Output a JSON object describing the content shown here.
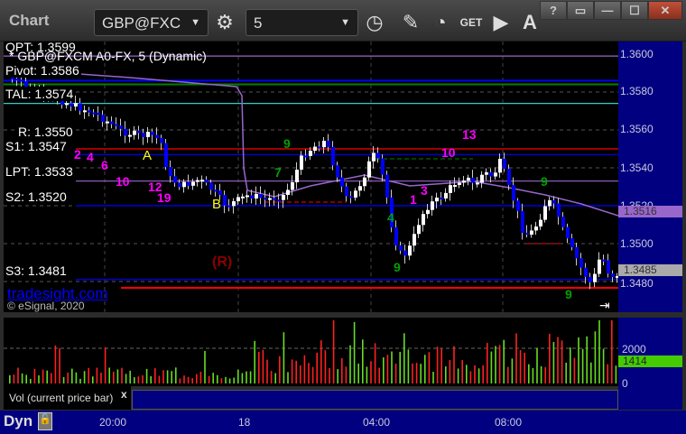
{
  "toolbar": {
    "title": "Chart",
    "symbol": "GBP@FXC",
    "interval": "5",
    "icons": [
      "gear-icon",
      "clock-icon",
      "pencil-icon",
      "studies-icon",
      "get-icon",
      "play-icon",
      "alert-icon"
    ],
    "get_label": "GET",
    "alert_label": "A"
  },
  "window": {
    "help": "?",
    "minimize": "—",
    "maximize": "☐",
    "close": "✕"
  },
  "chart": {
    "title": "* GBP@FXCM A0-FX, 5 (Dynamic)",
    "levels": [
      {
        "label": "QPT: 1.3599",
        "price": 1.3599,
        "color": "#9966cc"
      },
      {
        "label": "Pivot: 1.3586",
        "price": 1.3586,
        "color": "#0000ff"
      },
      {
        "label": "TAL: 1.3574",
        "price": 1.3574,
        "color": "#33cccc"
      },
      {
        "label": "R: 1.3550",
        "price": 1.355,
        "color": "#ff0000"
      },
      {
        "label": "S1: 1.3547",
        "price": 1.3547,
        "color": "#0000ff"
      },
      {
        "label": "LPT: 1.3533",
        "price": 1.3533,
        "color": "#9966cc"
      },
      {
        "label": "S2: 1.3520",
        "price": 1.352,
        "color": "#0000ff"
      },
      {
        "label": "S3: 1.3481",
        "price": 1.3481,
        "color": "#0000ff"
      }
    ],
    "price_ticks": [
      "1.3600",
      "1.3580",
      "1.3560",
      "1.3540",
      "1.3520",
      "1.3500",
      "1.3480"
    ],
    "ma_value": "1.3516",
    "last_price": "1.3485",
    "markers": {
      "a": "A",
      "b": "B",
      "r": "(R)"
    },
    "watermark": "tradesight.com",
    "copyright": "© eSignal, 2020",
    "colors": {
      "up": "#ffffff",
      "down": "#0000ff",
      "ma": "#9966cc",
      "background": "#000000",
      "axis": "#000080"
    }
  },
  "volume": {
    "label": "Vol (current price bar)",
    "close": "x",
    "ticks": [
      "2000",
      "0"
    ],
    "current": "1414"
  },
  "time_axis": {
    "mode": "Dyn",
    "ticks": [
      "20:00",
      "18",
      "04:00",
      "08:00"
    ]
  }
}
